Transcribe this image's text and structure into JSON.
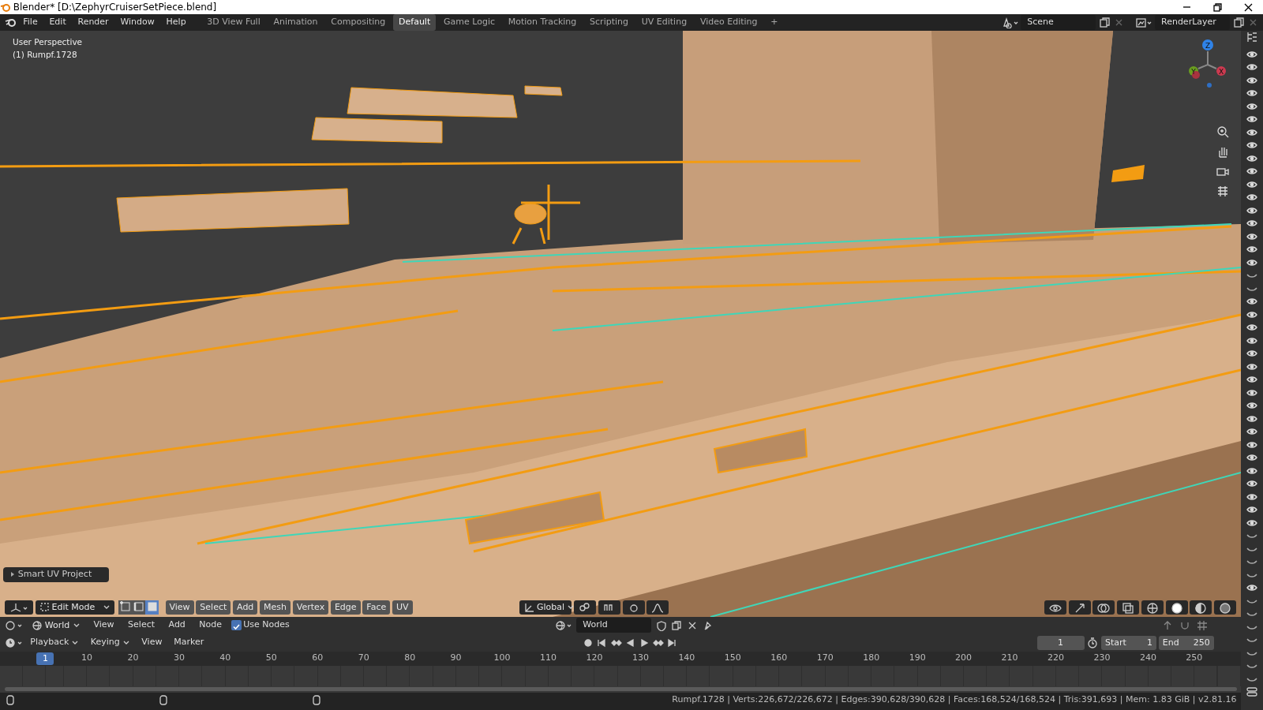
{
  "window": {
    "title": "Blender* [D:\\ZephyrCruiserSetPiece.blend]"
  },
  "menu": [
    "File",
    "Edit",
    "Render",
    "Window",
    "Help"
  ],
  "workspaces": [
    {
      "label": "3D View Full",
      "selected": false
    },
    {
      "label": "Animation",
      "selected": false
    },
    {
      "label": "Compositing",
      "selected": false
    },
    {
      "label": "Default",
      "selected": true
    },
    {
      "label": "Game Logic",
      "selected": false
    },
    {
      "label": "Motion Tracking",
      "selected": false
    },
    {
      "label": "Scripting",
      "selected": false
    },
    {
      "label": "UV Editing",
      "selected": false
    },
    {
      "label": "Video Editing",
      "selected": false
    }
  ],
  "add_workspace": "+",
  "scene": {
    "value": "Scene"
  },
  "view_layer": {
    "value": "RenderLayer"
  },
  "viewport": {
    "overlay_lines": [
      "User Perspective",
      "(1) Rumpf.1728"
    ],
    "axis_labels": [
      "Z",
      "Y",
      "X"
    ],
    "last_operator": "Smart UV Project",
    "header": {
      "mode": "Edit Mode",
      "select_modes": [
        {
          "selected": false
        },
        {
          "selected": false
        },
        {
          "selected": true
        }
      ],
      "menus": [
        "View",
        "Select",
        "Add",
        "Mesh",
        "Vertex",
        "Edge",
        "Face",
        "UV"
      ],
      "orientation": "Global"
    }
  },
  "shader_header": {
    "world_type": "World",
    "menus": [
      "View",
      "Select",
      "Add",
      "Node"
    ],
    "use_nodes": {
      "label": "Use Nodes",
      "checked": true
    },
    "world": "World"
  },
  "timeline": {
    "menus": [
      "Playback",
      "Keying",
      "View",
      "Marker"
    ],
    "current_frame": "1",
    "start_label": "Start",
    "start": "1",
    "end_label": "End",
    "end": "250",
    "ticks": [
      "10",
      "20",
      "30",
      "40",
      "50",
      "60",
      "70",
      "80",
      "90",
      "100",
      "110",
      "120",
      "130",
      "140",
      "150",
      "160",
      "170",
      "180",
      "190",
      "200",
      "210",
      "220",
      "230",
      "240",
      "250"
    ],
    "playhead": "1"
  },
  "status_bar": "Rumpf.1728 | Verts:226,672/226,672 | Edges:390,628/390,628 | Faces:168,524/168,524 | Tris:391,693 | Mem: 1.83 GiB | v2.81.16"
}
